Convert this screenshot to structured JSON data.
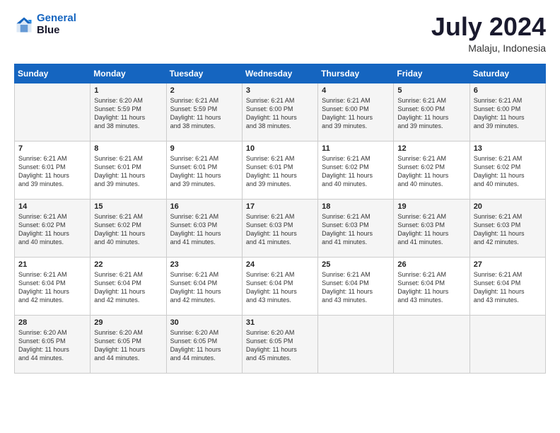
{
  "logo": {
    "line1": "General",
    "line2": "Blue"
  },
  "title": "July 2024",
  "location": "Malaju, Indonesia",
  "header": {
    "days": [
      "Sunday",
      "Monday",
      "Tuesday",
      "Wednesday",
      "Thursday",
      "Friday",
      "Saturday"
    ]
  },
  "weeks": [
    [
      {
        "day": "",
        "sunrise": "",
        "sunset": "",
        "daylight": ""
      },
      {
        "day": "1",
        "sunrise": "6:20 AM",
        "sunset": "5:59 PM",
        "daylight": "11 hours and 38 minutes."
      },
      {
        "day": "2",
        "sunrise": "6:21 AM",
        "sunset": "5:59 PM",
        "daylight": "11 hours and 38 minutes."
      },
      {
        "day": "3",
        "sunrise": "6:21 AM",
        "sunset": "6:00 PM",
        "daylight": "11 hours and 38 minutes."
      },
      {
        "day": "4",
        "sunrise": "6:21 AM",
        "sunset": "6:00 PM",
        "daylight": "11 hours and 39 minutes."
      },
      {
        "day": "5",
        "sunrise": "6:21 AM",
        "sunset": "6:00 PM",
        "daylight": "11 hours and 39 minutes."
      },
      {
        "day": "6",
        "sunrise": "6:21 AM",
        "sunset": "6:00 PM",
        "daylight": "11 hours and 39 minutes."
      }
    ],
    [
      {
        "day": "7",
        "sunrise": "6:21 AM",
        "sunset": "6:01 PM",
        "daylight": "11 hours and 39 minutes."
      },
      {
        "day": "8",
        "sunrise": "6:21 AM",
        "sunset": "6:01 PM",
        "daylight": "11 hours and 39 minutes."
      },
      {
        "day": "9",
        "sunrise": "6:21 AM",
        "sunset": "6:01 PM",
        "daylight": "11 hours and 39 minutes."
      },
      {
        "day": "10",
        "sunrise": "6:21 AM",
        "sunset": "6:01 PM",
        "daylight": "11 hours and 39 minutes."
      },
      {
        "day": "11",
        "sunrise": "6:21 AM",
        "sunset": "6:02 PM",
        "daylight": "11 hours and 40 minutes."
      },
      {
        "day": "12",
        "sunrise": "6:21 AM",
        "sunset": "6:02 PM",
        "daylight": "11 hours and 40 minutes."
      },
      {
        "day": "13",
        "sunrise": "6:21 AM",
        "sunset": "6:02 PM",
        "daylight": "11 hours and 40 minutes."
      }
    ],
    [
      {
        "day": "14",
        "sunrise": "6:21 AM",
        "sunset": "6:02 PM",
        "daylight": "11 hours and 40 minutes."
      },
      {
        "day": "15",
        "sunrise": "6:21 AM",
        "sunset": "6:02 PM",
        "daylight": "11 hours and 40 minutes."
      },
      {
        "day": "16",
        "sunrise": "6:21 AM",
        "sunset": "6:03 PM",
        "daylight": "11 hours and 41 minutes."
      },
      {
        "day": "17",
        "sunrise": "6:21 AM",
        "sunset": "6:03 PM",
        "daylight": "11 hours and 41 minutes."
      },
      {
        "day": "18",
        "sunrise": "6:21 AM",
        "sunset": "6:03 PM",
        "daylight": "11 hours and 41 minutes."
      },
      {
        "day": "19",
        "sunrise": "6:21 AM",
        "sunset": "6:03 PM",
        "daylight": "11 hours and 41 minutes."
      },
      {
        "day": "20",
        "sunrise": "6:21 AM",
        "sunset": "6:03 PM",
        "daylight": "11 hours and 42 minutes."
      }
    ],
    [
      {
        "day": "21",
        "sunrise": "6:21 AM",
        "sunset": "6:04 PM",
        "daylight": "11 hours and 42 minutes."
      },
      {
        "day": "22",
        "sunrise": "6:21 AM",
        "sunset": "6:04 PM",
        "daylight": "11 hours and 42 minutes."
      },
      {
        "day": "23",
        "sunrise": "6:21 AM",
        "sunset": "6:04 PM",
        "daylight": "11 hours and 42 minutes."
      },
      {
        "day": "24",
        "sunrise": "6:21 AM",
        "sunset": "6:04 PM",
        "daylight": "11 hours and 43 minutes."
      },
      {
        "day": "25",
        "sunrise": "6:21 AM",
        "sunset": "6:04 PM",
        "daylight": "11 hours and 43 minutes."
      },
      {
        "day": "26",
        "sunrise": "6:21 AM",
        "sunset": "6:04 PM",
        "daylight": "11 hours and 43 minutes."
      },
      {
        "day": "27",
        "sunrise": "6:21 AM",
        "sunset": "6:04 PM",
        "daylight": "11 hours and 43 minutes."
      }
    ],
    [
      {
        "day": "28",
        "sunrise": "6:20 AM",
        "sunset": "6:05 PM",
        "daylight": "11 hours and 44 minutes."
      },
      {
        "day": "29",
        "sunrise": "6:20 AM",
        "sunset": "6:05 PM",
        "daylight": "11 hours and 44 minutes."
      },
      {
        "day": "30",
        "sunrise": "6:20 AM",
        "sunset": "6:05 PM",
        "daylight": "11 hours and 44 minutes."
      },
      {
        "day": "31",
        "sunrise": "6:20 AM",
        "sunset": "6:05 PM",
        "daylight": "11 hours and 45 minutes."
      },
      {
        "day": "",
        "sunrise": "",
        "sunset": "",
        "daylight": ""
      },
      {
        "day": "",
        "sunrise": "",
        "sunset": "",
        "daylight": ""
      },
      {
        "day": "",
        "sunrise": "",
        "sunset": "",
        "daylight": ""
      }
    ]
  ]
}
